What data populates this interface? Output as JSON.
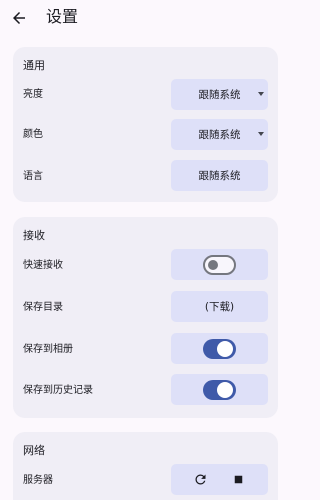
{
  "header": {
    "title": "设置"
  },
  "general": {
    "title": "通用",
    "brightness": {
      "label": "亮度",
      "value": "跟随系统"
    },
    "color": {
      "label": "颜色",
      "value": "跟随系统"
    },
    "language": {
      "label": "语言",
      "value": "跟随系统"
    }
  },
  "receive": {
    "title": "接收",
    "quick_receive": {
      "label": "快速接收",
      "enabled": false
    },
    "save_dir": {
      "label": "保存目录",
      "value": "(下载)"
    },
    "save_to_album": {
      "label": "保存到相册",
      "enabled": true
    },
    "save_to_history": {
      "label": "保存到历史记录",
      "enabled": true
    }
  },
  "network": {
    "title": "网络",
    "server": {
      "label": "服务器",
      "restart_icon": "refresh-icon",
      "stop_icon": "stop-icon"
    }
  },
  "colors": {
    "accent": "#3f5aa9",
    "control_bg": "#dee0f8",
    "card_bg": "#f0eef6",
    "page_bg": "#fcf8fd"
  }
}
